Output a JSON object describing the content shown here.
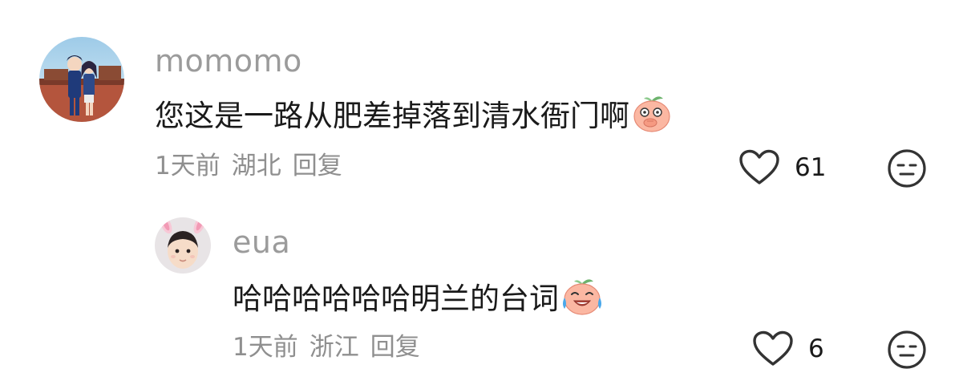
{
  "comments": [
    {
      "username": "momomo",
      "text": "您这是一路从肥差掉落到清水衙门啊",
      "emoji": "peach-covering-mouth-emoji",
      "time": "1天前",
      "location": "湖北",
      "reply_label": "回复",
      "likes": "61",
      "avatar": "anime-couple-avatar"
    },
    {
      "username": "eua",
      "text": "哈哈哈哈哈哈明兰的台词",
      "emoji": "peach-crying-laughing-emoji",
      "time": "1天前",
      "location": "浙江",
      "reply_label": "回复",
      "likes": "6",
      "avatar": "child-with-bunny-ears-avatar"
    }
  ],
  "icons": {
    "like": "heart-outline-icon",
    "dislike": "neutral-face-icon"
  },
  "colors": {
    "username": "#9b9b9b",
    "meta": "#8f8f8f",
    "text": "#1a1a1a",
    "icon": "#333333"
  }
}
